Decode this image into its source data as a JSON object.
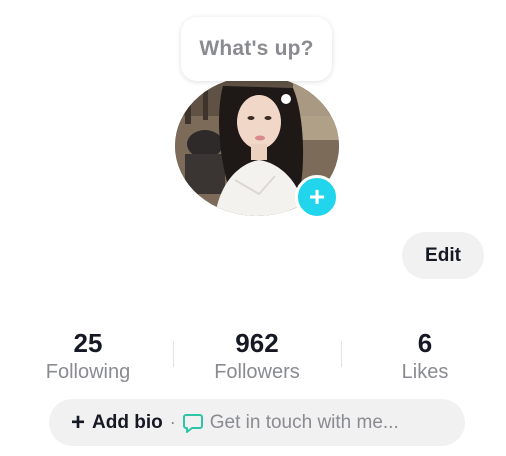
{
  "note": {
    "text": "What's up?"
  },
  "profile": {
    "edit_label": "Edit",
    "add_story_symbol": "+"
  },
  "stats": [
    {
      "count": "25",
      "label": "Following"
    },
    {
      "count": "962",
      "label": "Followers"
    },
    {
      "count": "6",
      "label": "Likes"
    }
  ],
  "bio": {
    "add_icon": "+",
    "add_bio_label": "Add bio",
    "separator": "·",
    "contact_label": "Get in touch with me..."
  },
  "colors": {
    "accent": "#20d5ec",
    "contact_icon": "#2ec4a6",
    "muted_text": "#8a8b91",
    "pill_bg": "#f1f1f2"
  },
  "icons": {
    "add_story": "plus-icon",
    "add_bio": "plus-icon",
    "contact": "chat-bubble-icon"
  }
}
